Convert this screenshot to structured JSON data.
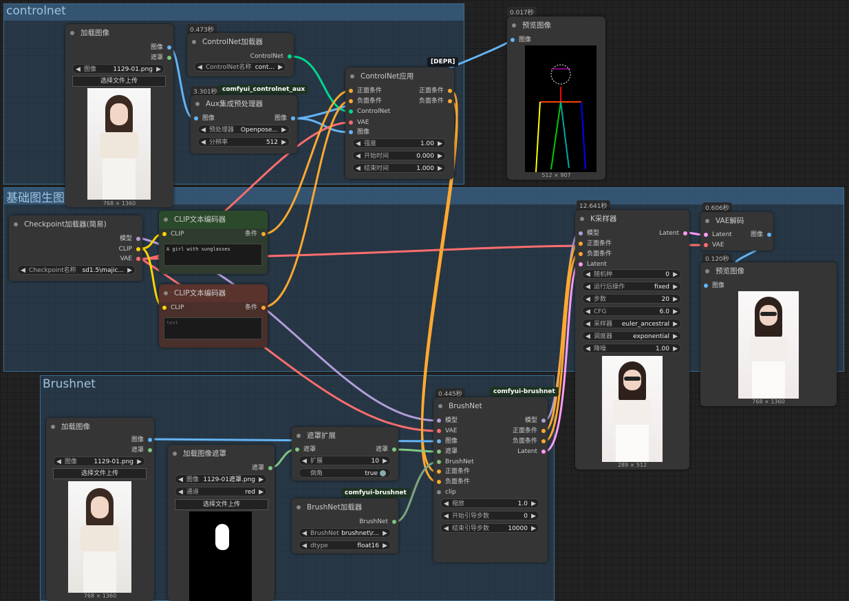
{
  "groups": {
    "controlnet": "controlnet",
    "img2img": "基础图生图",
    "brushnet": "Brushnet"
  },
  "colors": {
    "image": "#64b5f6",
    "mask": "#81c784",
    "clip": "#ffd500",
    "vae": "#ff6e6e",
    "model": "#b39ddb",
    "cond": "#ffa931",
    "latent": "#ff9cf9",
    "controlnet": "#00d78d",
    "brushnet": "#7fc37f"
  },
  "load_image_top": {
    "title": "加载图像",
    "out_image": "图像",
    "out_mask": "遮罩",
    "w_label": "图像",
    "w_value": "1129-01.png",
    "upload": "选择文件上传",
    "caption": "768 × 1360"
  },
  "cn_loader": {
    "time": "0.473秒",
    "title": "ControlNet加载器",
    "out": "ControlNet",
    "w_label": "ControlNet名称",
    "w_value": "cont..."
  },
  "aux": {
    "time": "3.301秒",
    "badge": "comfyui_controlnet_aux",
    "title": "Aux集成预处理器",
    "in_image": "图像",
    "out_image": "图像",
    "w1_label": "预处理器",
    "w1_value": "Openpose...",
    "w2_label": "分辨率",
    "w2_value": "512"
  },
  "cn_apply": {
    "badge": "[DEPR]",
    "title": "ControlNet应用",
    "in1": "正面条件",
    "in2": "负面条件",
    "in3": "ControlNet",
    "in4": "VAE",
    "in5": "图像",
    "out1": "正面条件",
    "out2": "负面条件",
    "w1_label": "强度",
    "w1_value": "1.00",
    "w2_label": "开始时间",
    "w2_value": "0.000",
    "w3_label": "结束时间",
    "w3_value": "1.000"
  },
  "preview_top": {
    "time": "0.017秒",
    "title": "预览图像",
    "in": "图像",
    "caption": "512 × 907"
  },
  "ckpt": {
    "title": "Checkpoint加载器(简易)",
    "out1": "模型",
    "out2": "CLIP",
    "out3": "VAE",
    "w_label": "Checkpoint名称",
    "w_value": "sd1.5\\majic..."
  },
  "clip_pos": {
    "title": "CLIP文本编码器",
    "in": "CLIP",
    "out": "条件",
    "text": "A girl with sunglasses"
  },
  "clip_neg": {
    "title": "CLIP文本编码器",
    "in": "CLIP",
    "out": "条件",
    "text": "text"
  },
  "ksampler": {
    "time": "12.641秒",
    "title": "K采样器",
    "in1": "模型",
    "in2": "正面条件",
    "in3": "负面条件",
    "in4": "Latent",
    "out": "Latent",
    "widgets": [
      {
        "label": "随机种",
        "value": "0"
      },
      {
        "label": "运行后操作",
        "value": "fixed"
      },
      {
        "label": "步数",
        "value": "20"
      },
      {
        "label": "CFG",
        "value": "6.0"
      },
      {
        "label": "采样器",
        "value": "euler_ancestral"
      },
      {
        "label": "调度器",
        "value": "exponential"
      },
      {
        "label": "降噪",
        "value": "1.00"
      }
    ],
    "caption": "289 × 512"
  },
  "vae_decode": {
    "time": "0.606秒",
    "title": "VAE解码",
    "in1": "Latent",
    "in2": "VAE",
    "out": "图像"
  },
  "preview_right": {
    "time": "0.120秒",
    "title": "预览图像",
    "in": "图像",
    "caption": "768 × 1360"
  },
  "load_image_bottom": {
    "title": "加载图像",
    "out_image": "图像",
    "out_mask": "遮罩",
    "w_label": "图像",
    "w_value": "1129-01.png",
    "upload": "选择文件上传",
    "caption": "768 × 1360"
  },
  "load_mask": {
    "title": "加载图像遮罩",
    "out": "遮罩",
    "w1_label": "图像",
    "w1_value": "1129-01遮罩.png",
    "w2_label": "通道",
    "w2_value": "red",
    "upload": "选择文件上传"
  },
  "mask_expand": {
    "title": "遮罩扩展",
    "in": "遮罩",
    "out": "遮罩",
    "w1_label": "扩展",
    "w1_value": "10",
    "w2_label": "倒角",
    "w2_value": "true"
  },
  "brushnet_loader": {
    "badge": "comfyui-brushnet",
    "title": "BrushNet加载器",
    "out": "BrushNet",
    "w1_label": "BrushNet",
    "w1_value": "brushnet\\r...",
    "w2_label": "dtype",
    "w2_value": "float16"
  },
  "brushnet": {
    "time": "0.445秒",
    "badge": "comfyui-brushnet",
    "title": "BrushNet",
    "in1": "模型",
    "in2": "VAE",
    "in3": "图像",
    "in4": "遮罩",
    "in5": "BrushNet",
    "in6": "正面条件",
    "in7": "负面条件",
    "in8": "clip",
    "out1": "模型",
    "out2": "正面条件",
    "out3": "负面条件",
    "out4": "Latent",
    "w1_label": "缩放",
    "w1_value": "1.0",
    "w2_label": "开始引导步数",
    "w2_value": "0",
    "w3_label": "结束引导步数",
    "w3_value": "10000"
  }
}
